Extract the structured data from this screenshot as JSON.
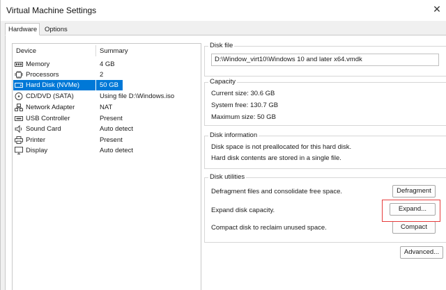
{
  "window": {
    "title": "Virtual Machine Settings"
  },
  "tabs": [
    {
      "label": "Hardware"
    },
    {
      "label": "Options"
    }
  ],
  "devices": {
    "col_device": "Device",
    "col_summary": "Summary",
    "items": [
      {
        "name": "Memory",
        "summary": "4 GB",
        "icon": "memory-icon"
      },
      {
        "name": "Processors",
        "summary": "2",
        "icon": "processor-icon"
      },
      {
        "name": "Hard Disk (NVMe)",
        "summary": "50 GB",
        "icon": "hard-disk-icon",
        "selected": true
      },
      {
        "name": "CD/DVD (SATA)",
        "summary": "Using file D:\\Windows.iso",
        "icon": "cd-dvd-icon"
      },
      {
        "name": "Network Adapter",
        "summary": "NAT",
        "icon": "network-adapter-icon"
      },
      {
        "name": "USB Controller",
        "summary": "Present",
        "icon": "usb-controller-icon"
      },
      {
        "name": "Sound Card",
        "summary": "Auto detect",
        "icon": "sound-card-icon"
      },
      {
        "name": "Printer",
        "summary": "Present",
        "icon": "printer-icon"
      },
      {
        "name": "Display",
        "summary": "Auto detect",
        "icon": "display-icon"
      }
    ]
  },
  "disk_file": {
    "title": "Disk file",
    "value": "D:\\Window_virt10\\Windows 10 and later x64.vmdk"
  },
  "capacity": {
    "title": "Capacity",
    "current": "Current size:  30.6 GB",
    "free": "System free:  130.7 GB",
    "max": "Maximum size:  50 GB"
  },
  "disk_info": {
    "title": "Disk information",
    "line1": "Disk space is not preallocated for this hard disk.",
    "line2": "Hard disk contents are stored in a single file."
  },
  "disk_utilities": {
    "title": "Disk utilities",
    "defrag_text": "Defragment files and consolidate free space.",
    "defrag_btn": "Defragment",
    "expand_text": "Expand disk capacity.",
    "expand_btn": "Expand...",
    "compact_text": "Compact disk to reclaim unused space.",
    "compact_btn": "Compact"
  },
  "advanced_btn": "Advanced...",
  "colors": {
    "selection": "#0078d7",
    "highlight": "#e63b3b"
  }
}
